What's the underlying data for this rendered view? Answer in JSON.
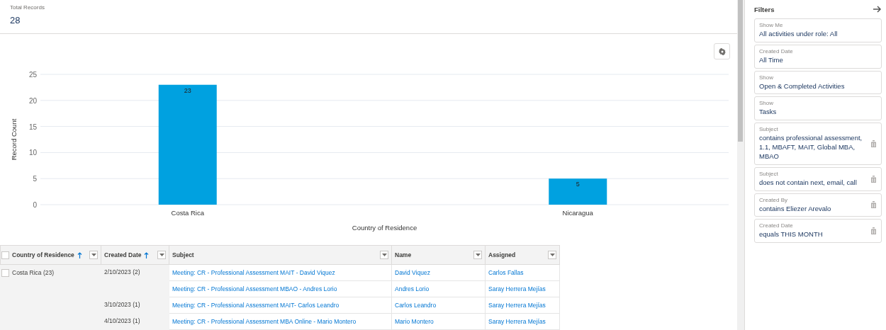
{
  "summary": {
    "label": "Total Records",
    "value": "28"
  },
  "chart": {
    "chart_data": {
      "type": "bar",
      "xlabel": "Country of Residence",
      "ylabel": "Record Count",
      "categories": [
        "Costa Rica",
        "Nicaragua"
      ],
      "values": [
        23,
        5
      ],
      "ylim": [
        0,
        25
      ],
      "grid": true,
      "yticks": [
        0,
        5,
        10,
        15,
        20,
        25
      ],
      "data_labels": true
    }
  },
  "table": {
    "columns": [
      {
        "label": "Country of Residence",
        "sorted": true
      },
      {
        "label": "Created Date",
        "sorted": true
      },
      {
        "label": "Subject",
        "sorted": false
      },
      {
        "label": "Name",
        "sorted": false
      },
      {
        "label": "Assigned",
        "sorted": false
      }
    ],
    "header_checked": false,
    "groups": [
      {
        "country": "Costa Rica (23)",
        "checked": false,
        "dates": [
          {
            "date": "2/10/2023 (2)",
            "rows": [
              {
                "subject": "Meeting: CR - Professional Assessment MAIT - David Viquez",
                "name": "David Viquez",
                "assigned": "Carlos Fallas"
              },
              {
                "subject": "Meeting: CR - Professional Assessment MBAO - Andres Lorio",
                "name": "Andres Lorio",
                "assigned": "Saray Herrera Mejías"
              }
            ]
          },
          {
            "date": "3/10/2023 (1)",
            "rows": [
              {
                "subject": "Meeting: CR - Professional Assessment MAIT- Carlos Leandro",
                "name": "Carlos Leandro",
                "assigned": "Saray Herrera Mejías"
              }
            ]
          },
          {
            "date": "4/10/2023 (1)",
            "rows": [
              {
                "subject": "Meeting: CR - Professional Assessment MBA Online - Mario Montero",
                "name": "Mario Montero",
                "assigned": "Saray Herrera Mejías"
              }
            ]
          }
        ]
      }
    ]
  },
  "filters": {
    "title": "Filters",
    "items": [
      {
        "label": "Show Me",
        "value": "All activities under role: All",
        "removable": false
      },
      {
        "label": "Created Date",
        "value": "All Time",
        "removable": false
      },
      {
        "label": "Show",
        "value": "Open & Completed Activities",
        "removable": false
      },
      {
        "label": "Show",
        "value": "Tasks",
        "removable": false
      },
      {
        "label": "Subject",
        "value": "contains professional assessment, 1.1, MBAFT, MAIT, Global MBA, MBAO",
        "removable": true
      },
      {
        "label": "Subject",
        "value": "does not contain next, email, call",
        "removable": true
      },
      {
        "label": "Created By",
        "value": "contains Eliezer Arevalo",
        "removable": true
      },
      {
        "label": "Created Date",
        "value": "equals THIS MONTH",
        "removable": true
      }
    ]
  }
}
